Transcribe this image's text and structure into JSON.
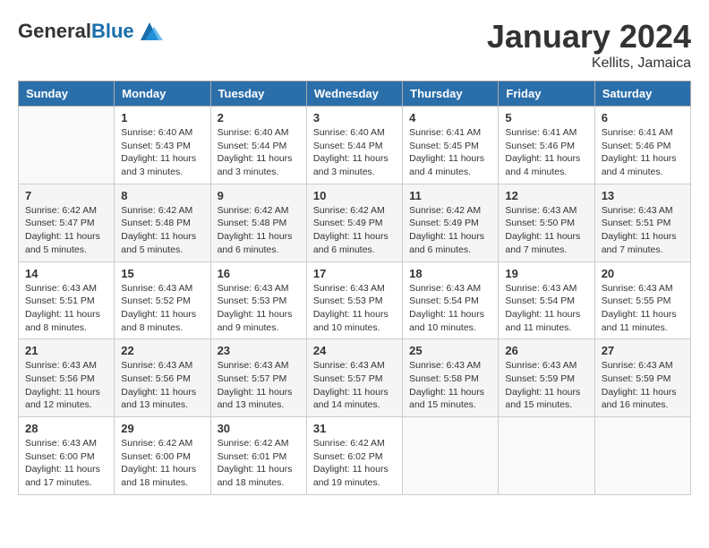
{
  "header": {
    "logo_general": "General",
    "logo_blue": "Blue",
    "month_title": "January 2024",
    "location": "Kellits, Jamaica"
  },
  "days_of_week": [
    "Sunday",
    "Monday",
    "Tuesday",
    "Wednesday",
    "Thursday",
    "Friday",
    "Saturday"
  ],
  "weeks": [
    [
      {
        "day": "",
        "info": ""
      },
      {
        "day": "1",
        "info": "Sunrise: 6:40 AM\nSunset: 5:43 PM\nDaylight: 11 hours\nand 3 minutes."
      },
      {
        "day": "2",
        "info": "Sunrise: 6:40 AM\nSunset: 5:44 PM\nDaylight: 11 hours\nand 3 minutes."
      },
      {
        "day": "3",
        "info": "Sunrise: 6:40 AM\nSunset: 5:44 PM\nDaylight: 11 hours\nand 3 minutes."
      },
      {
        "day": "4",
        "info": "Sunrise: 6:41 AM\nSunset: 5:45 PM\nDaylight: 11 hours\nand 4 minutes."
      },
      {
        "day": "5",
        "info": "Sunrise: 6:41 AM\nSunset: 5:46 PM\nDaylight: 11 hours\nand 4 minutes."
      },
      {
        "day": "6",
        "info": "Sunrise: 6:41 AM\nSunset: 5:46 PM\nDaylight: 11 hours\nand 4 minutes."
      }
    ],
    [
      {
        "day": "7",
        "info": "Sunrise: 6:42 AM\nSunset: 5:47 PM\nDaylight: 11 hours\nand 5 minutes."
      },
      {
        "day": "8",
        "info": "Sunrise: 6:42 AM\nSunset: 5:48 PM\nDaylight: 11 hours\nand 5 minutes."
      },
      {
        "day": "9",
        "info": "Sunrise: 6:42 AM\nSunset: 5:48 PM\nDaylight: 11 hours\nand 6 minutes."
      },
      {
        "day": "10",
        "info": "Sunrise: 6:42 AM\nSunset: 5:49 PM\nDaylight: 11 hours\nand 6 minutes."
      },
      {
        "day": "11",
        "info": "Sunrise: 6:42 AM\nSunset: 5:49 PM\nDaylight: 11 hours\nand 6 minutes."
      },
      {
        "day": "12",
        "info": "Sunrise: 6:43 AM\nSunset: 5:50 PM\nDaylight: 11 hours\nand 7 minutes."
      },
      {
        "day": "13",
        "info": "Sunrise: 6:43 AM\nSunset: 5:51 PM\nDaylight: 11 hours\nand 7 minutes."
      }
    ],
    [
      {
        "day": "14",
        "info": "Sunrise: 6:43 AM\nSunset: 5:51 PM\nDaylight: 11 hours\nand 8 minutes."
      },
      {
        "day": "15",
        "info": "Sunrise: 6:43 AM\nSunset: 5:52 PM\nDaylight: 11 hours\nand 8 minutes."
      },
      {
        "day": "16",
        "info": "Sunrise: 6:43 AM\nSunset: 5:53 PM\nDaylight: 11 hours\nand 9 minutes."
      },
      {
        "day": "17",
        "info": "Sunrise: 6:43 AM\nSunset: 5:53 PM\nDaylight: 11 hours\nand 10 minutes."
      },
      {
        "day": "18",
        "info": "Sunrise: 6:43 AM\nSunset: 5:54 PM\nDaylight: 11 hours\nand 10 minutes."
      },
      {
        "day": "19",
        "info": "Sunrise: 6:43 AM\nSunset: 5:54 PM\nDaylight: 11 hours\nand 11 minutes."
      },
      {
        "day": "20",
        "info": "Sunrise: 6:43 AM\nSunset: 5:55 PM\nDaylight: 11 hours\nand 11 minutes."
      }
    ],
    [
      {
        "day": "21",
        "info": "Sunrise: 6:43 AM\nSunset: 5:56 PM\nDaylight: 11 hours\nand 12 minutes."
      },
      {
        "day": "22",
        "info": "Sunrise: 6:43 AM\nSunset: 5:56 PM\nDaylight: 11 hours\nand 13 minutes."
      },
      {
        "day": "23",
        "info": "Sunrise: 6:43 AM\nSunset: 5:57 PM\nDaylight: 11 hours\nand 13 minutes."
      },
      {
        "day": "24",
        "info": "Sunrise: 6:43 AM\nSunset: 5:57 PM\nDaylight: 11 hours\nand 14 minutes."
      },
      {
        "day": "25",
        "info": "Sunrise: 6:43 AM\nSunset: 5:58 PM\nDaylight: 11 hours\nand 15 minutes."
      },
      {
        "day": "26",
        "info": "Sunrise: 6:43 AM\nSunset: 5:59 PM\nDaylight: 11 hours\nand 15 minutes."
      },
      {
        "day": "27",
        "info": "Sunrise: 6:43 AM\nSunset: 5:59 PM\nDaylight: 11 hours\nand 16 minutes."
      }
    ],
    [
      {
        "day": "28",
        "info": "Sunrise: 6:43 AM\nSunset: 6:00 PM\nDaylight: 11 hours\nand 17 minutes."
      },
      {
        "day": "29",
        "info": "Sunrise: 6:42 AM\nSunset: 6:00 PM\nDaylight: 11 hours\nand 18 minutes."
      },
      {
        "day": "30",
        "info": "Sunrise: 6:42 AM\nSunset: 6:01 PM\nDaylight: 11 hours\nand 18 minutes."
      },
      {
        "day": "31",
        "info": "Sunrise: 6:42 AM\nSunset: 6:02 PM\nDaylight: 11 hours\nand 19 minutes."
      },
      {
        "day": "",
        "info": ""
      },
      {
        "day": "",
        "info": ""
      },
      {
        "day": "",
        "info": ""
      }
    ]
  ]
}
